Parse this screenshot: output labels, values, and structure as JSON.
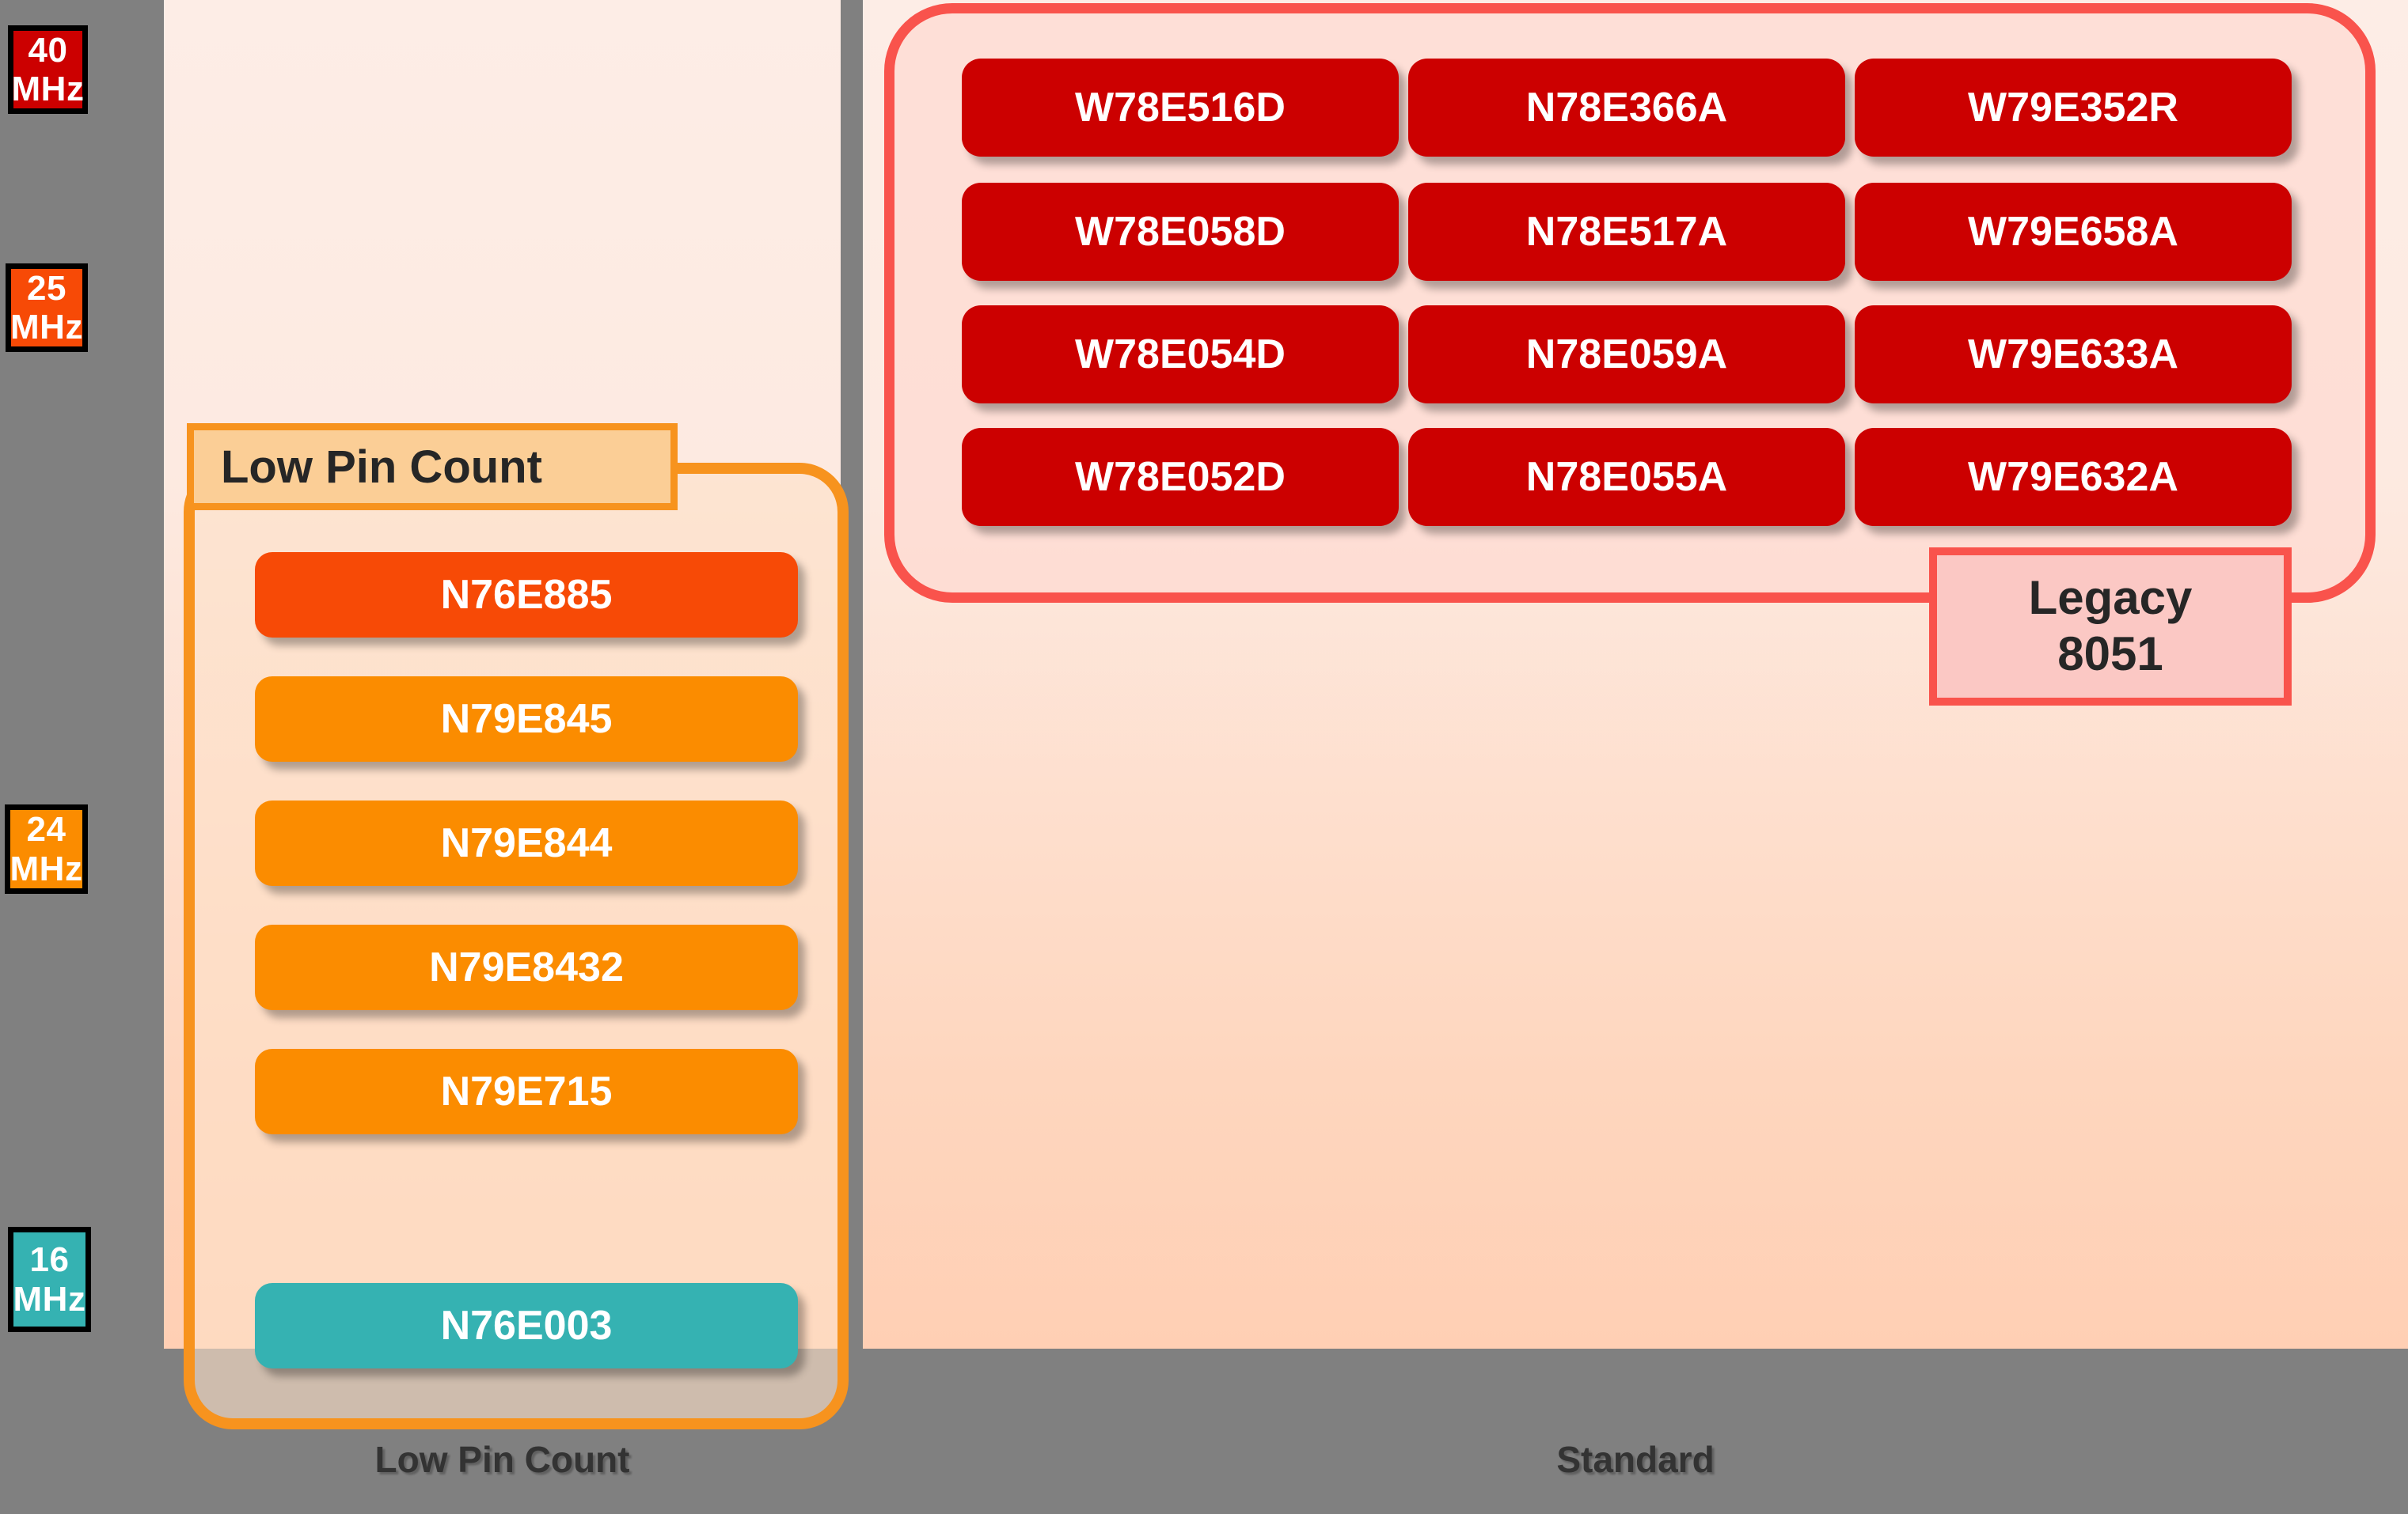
{
  "axis": {
    "frequencies": [
      {
        "value": "40",
        "unit": "MHz",
        "color": "#CC0000"
      },
      {
        "value": "25",
        "unit": "MHz",
        "color": "#F74A06"
      },
      {
        "value": "24",
        "unit": "MHz",
        "color": "#FB8C00"
      },
      {
        "value": "16",
        "unit": "MHz",
        "color": "#35B2B2"
      }
    ],
    "columns": [
      {
        "label": "Low Pin Count"
      },
      {
        "label": "Standard"
      }
    ]
  },
  "low_pin_count": {
    "badge_label": "Low Pin Count",
    "border_color": "#F7931E",
    "parts": [
      {
        "name": "N76E885",
        "color": "#F74A06"
      },
      {
        "name": "N79E845",
        "color": "#FB8C00"
      },
      {
        "name": "N79E844",
        "color": "#FB8C00"
      },
      {
        "name": "N79E8432",
        "color": "#FB8C00"
      },
      {
        "name": "N79E715",
        "color": "#FB8C00"
      },
      {
        "name": "N76E003",
        "color": "#35B2B2"
      }
    ]
  },
  "legacy_8051": {
    "badge_line1": "Legacy",
    "badge_line2": "8051",
    "border_color": "#F9534C",
    "chip_color": "#CC0000",
    "rows": [
      [
        "W78E516D",
        "N78E366A",
        "W79E352R"
      ],
      [
        "W78E058D",
        "N78E517A",
        "W79E658A"
      ],
      [
        "W78E054D",
        "N78E059A",
        "W79E633A"
      ],
      [
        "W78E052D",
        "N78E055A",
        "W79E632A"
      ]
    ]
  }
}
